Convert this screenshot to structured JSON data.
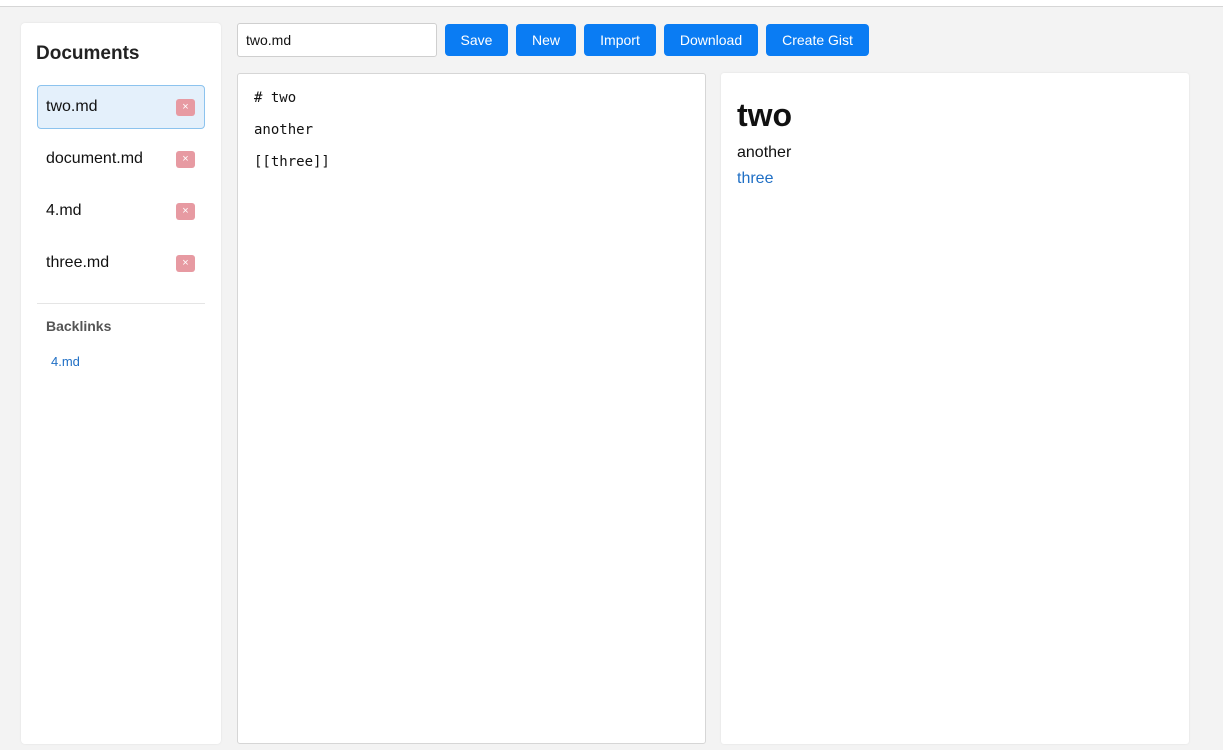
{
  "sidebar": {
    "title": "Documents",
    "documents": [
      {
        "name": "two.md",
        "delete_label": "×"
      },
      {
        "name": "document.md",
        "delete_label": "×"
      },
      {
        "name": "4.md",
        "delete_label": "×"
      },
      {
        "name": "three.md",
        "delete_label": "×"
      }
    ],
    "backlinks_title": "Backlinks",
    "backlinks": [
      "4.md"
    ]
  },
  "toolbar": {
    "filename_value": "two.md",
    "save_label": "Save",
    "new_label": "New",
    "import_label": "Import",
    "download_label": "Download",
    "gist_label": "Create Gist"
  },
  "editor": {
    "lines": [
      "# two",
      "another",
      "[[three]]"
    ]
  },
  "preview": {
    "heading": "two",
    "paragraph": "another",
    "link": "three"
  },
  "colors": {
    "accent": "#0a7cf3",
    "link": "#1f6fc5",
    "active_bg": "#e4f0fb",
    "delete_bg": "#e79aa2"
  }
}
